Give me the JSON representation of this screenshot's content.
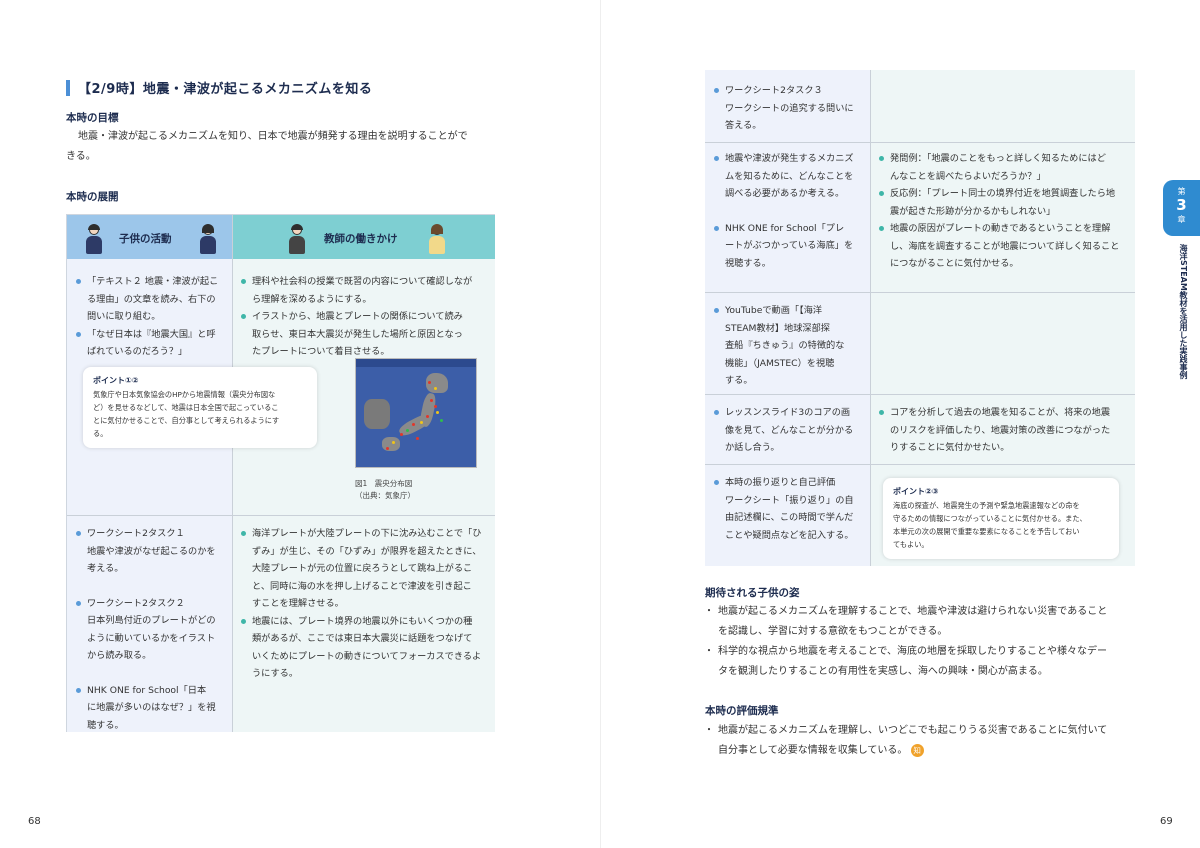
{
  "left_page": {
    "lesson_title": "【2/9時】地震・津波が起こるメカニズムを知る",
    "goal_heading": "本時の目標",
    "goal_line1": "地震・津波が起こるメカニズムを知り、日本で地震が頻発する理由を説明することがで",
    "goal_line2": "きる。",
    "flow_heading": "本時の展開",
    "table": {
      "header_child": "子供の活動",
      "header_teacher": "教師の働きかけ",
      "row1": {
        "child": [
          [
            "「テキスト２ 地震・津波が起こ",
            "る理由」の文章を読み、右下の",
            "問いに取り組む。"
          ],
          [
            "「なぜ日本は『地震大国』と呼",
            "ばれているのだろう？」"
          ]
        ],
        "teacher": [
          [
            "理科や社会科の授業で既習の内容について確認しなが",
            "ら理解を深めるようにする。"
          ],
          [
            "イラストから、地震とプレートの関係について読み",
            "取らせ、東日本大震災が発生した場所と原因となっ",
            "たプレートについて着目させる。"
          ]
        ],
        "point_title": "ポイント①②",
        "point_lines": [
          "気象庁や日本気象協会のHPから地震情報（震央分布図な",
          "ど）を見せるなどして、地震は日本全国で起こっているこ",
          "とに気付かせることで、自分事として考えられるようにす",
          "る。"
        ],
        "figure_caption1": "図1　震央分布図",
        "figure_caption2": "（出典：気象庁）"
      },
      "row2": {
        "child": [
          [
            "ワークシート2タスク１",
            "地震や津波がなぜ起こるのかを",
            "考える。"
          ],
          [
            "ワークシート2タスク２",
            "日本列島付近のプレートがどの",
            "ように動いているかをイラスト",
            "から読み取る。"
          ],
          [
            "NHK ONE for School「日本",
            "に地震が多いのはなぜ？」を視",
            "聴する。"
          ]
        ],
        "teacher": [
          [
            "海洋プレートが大陸プレートの下に沈み込むことで「ひ",
            "ずみ」が生じ、その「ひずみ」が限界を超えたときに、",
            "大陸プレートが元の位置に戻ろうとして跳ね上がるこ",
            "と、同時に海の水を押し上げることで津波を引き起こ",
            "すことを理解させる。"
          ],
          [
            "地震には、プレート境界の地震以外にもいくつかの種",
            "類があるが、ここでは東日本大震災に話題をつなげて",
            "いくためにプレートの動きについてフォーカスできるよ",
            "うにする。"
          ]
        ]
      }
    },
    "page_number": "68"
  },
  "right_page": {
    "rows": [
      {
        "child": [
          [
            "ワークシート2タスク３",
            "ワークシートの追究する問いに",
            "答える。"
          ]
        ],
        "teacher": []
      },
      {
        "child": [
          [
            "地震や津波が発生するメカニズ",
            "ムを知るために、どんなことを",
            "調べる必要があるか考える。"
          ],
          [
            "NHK ONE for School「プレ",
            "ートがぶつかっている海底」を",
            "視聴する。"
          ]
        ],
        "teacher": [
          [
            "発問例：「地震のことをもっと詳しく知るためにはど",
            "んなことを調べたらよいだろうか？」"
          ],
          [
            "反応例：「プレート同士の境界付近を地質調査したら地",
            "震が起きた形跡が分かるかもしれない」"
          ],
          [
            "地震の原因がプレートの動きであるということを理解",
            "し、海底を調査することが地震について詳しく知ること",
            "につながることに気付かせる。"
          ]
        ]
      },
      {
        "child": [
          [
            "YouTubeで動画「【海洋",
            "STEAM教材】地球深部探",
            "査船『ちきゅう』の特徴的な",
            "機能」（JAMSTEC）を視聴",
            "する。"
          ]
        ],
        "teacher": []
      },
      {
        "child": [
          [
            "レッスンスライド3のコアの画",
            "像を見て、どんなことが分かる",
            "か話し合う。"
          ]
        ],
        "teacher": [
          [
            "コアを分析して過去の地震を知ることが、将来の地震",
            "のリスクを評価したり、地震対策の改善につながった",
            "りすることに気付かせたい。"
          ]
        ]
      },
      {
        "child": [
          [
            "本時の振り返りと自己評価",
            "ワークシート「振り返り」の自",
            "由記述欄に、この時間で学んだ",
            "ことや疑問点などを記入する。"
          ]
        ],
        "teacher": [],
        "point_title": "ポイント②③",
        "point_lines": [
          "海底の探査が、地震発生の予測や緊急地震速報などの命を",
          "守るための情報につながっていることに気付かせる。また、",
          "本単元の次の展開で重要な要素になることを予告しておい",
          "てもよい。"
        ]
      }
    ],
    "expected_heading": "期待される子供の姿",
    "expected_items": [
      [
        "地震が起こるメカニズムを理解することで、地震や津波は避けられない災害であること",
        "を認識し、学習に対する意欲をもつことができる。"
      ],
      [
        "科学的な視点から地震を考えることで、海底の地層を採取したりすることや様々なデー",
        "タを観測したりすることの有用性を実感し、海への興味・関心が高まる。"
      ]
    ],
    "eval_heading": "本時の評価規準",
    "eval_line1": "地震が起こるメカニズムを理解し、いつどこでも起こりうる災害であることに気付いて",
    "eval_line2": "自分事として必要な情報を収集している。",
    "eval_badge": "知",
    "chapter_tab_small": "第",
    "chapter_tab_num": "3",
    "chapter_tab_suffix": "章",
    "side_label": "海洋STEAM教材を活用した実践事例",
    "page_number": "69"
  },
  "colors": {
    "header_child": "#9cc6ea",
    "header_teacher": "#7ecfd2",
    "tab": "#2f8bd0",
    "badge": "#f0a22b"
  }
}
